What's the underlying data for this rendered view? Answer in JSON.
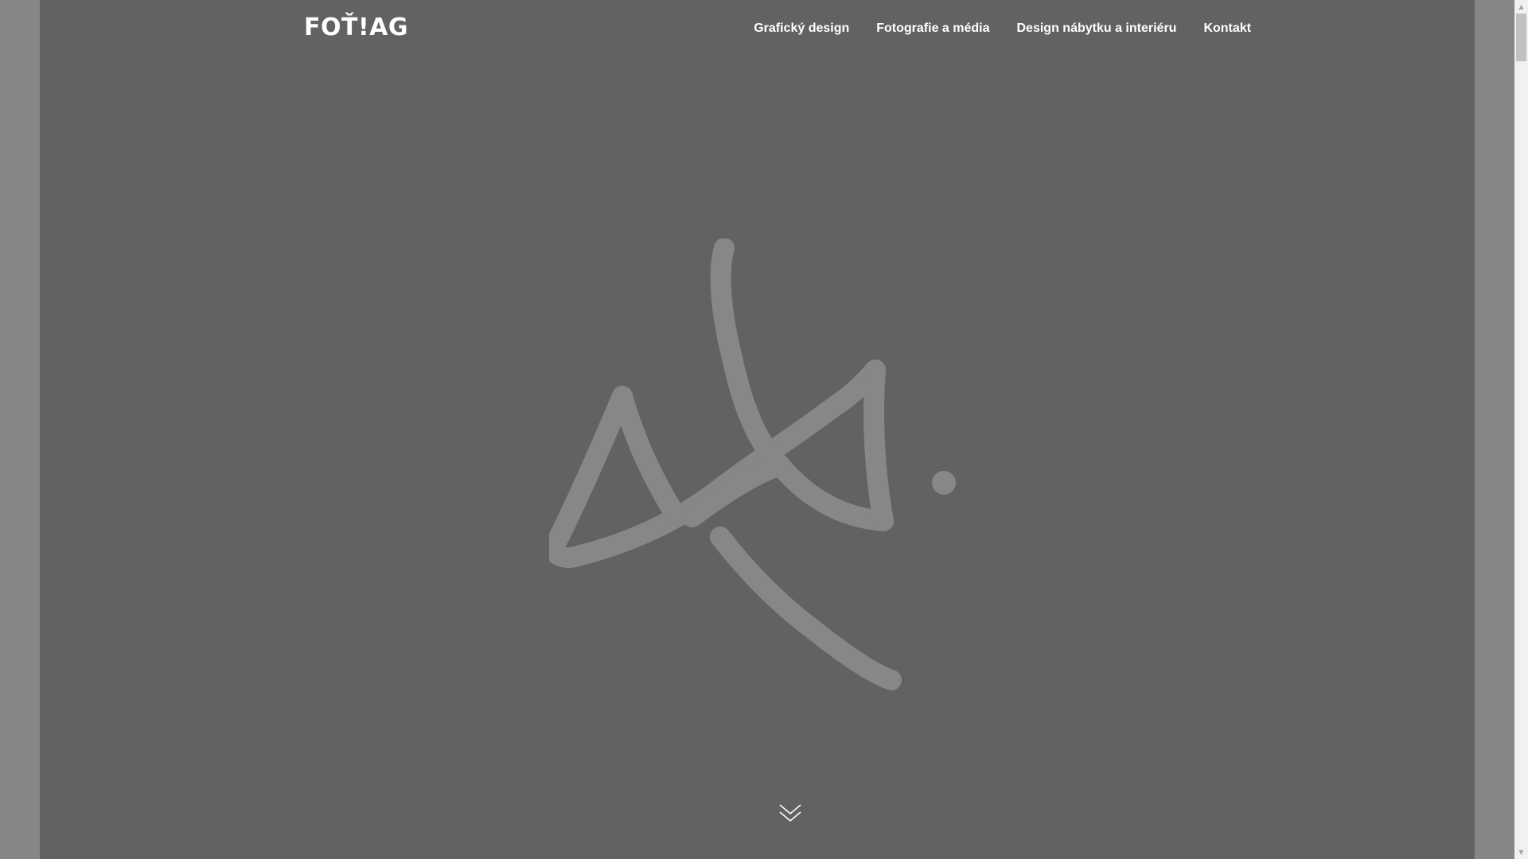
{
  "header": {
    "logo_text": "FOŤ!AG",
    "nav": [
      "Grafický design",
      "Fotografie a média",
      "Design nábytku a interiéru",
      "Kontakt"
    ]
  },
  "hero": {
    "mark_icon": "signature-ak-logo",
    "scroll_icon": "double-chevron-down-icon"
  },
  "colors": {
    "page_background": "#626262",
    "outer_background": "#868686",
    "mark_color": "#878787",
    "nav_text": "#ffffff"
  }
}
